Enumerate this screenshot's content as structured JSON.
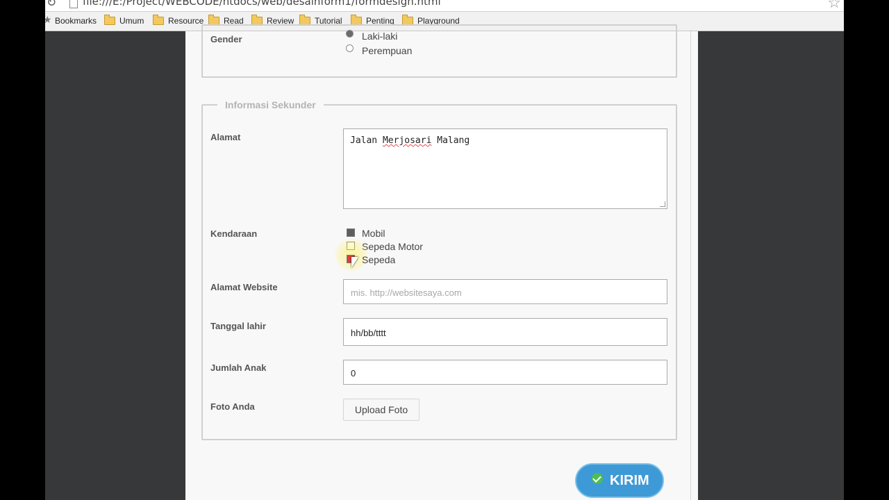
{
  "browser": {
    "url": "file:///E:/Project/WEBCODE/htdocs/web/desainform1/formdesign.html",
    "bookmarks_label": "Bookmarks",
    "folders": [
      "Umum",
      "Resource",
      "Read",
      "Review",
      "Tutorial",
      "Penting",
      "Playground"
    ]
  },
  "form": {
    "gender": {
      "label": "Gender",
      "options": [
        {
          "label": "Laki-laki",
          "checked": true
        },
        {
          "label": "Perempuan",
          "checked": false
        }
      ]
    },
    "secondary": {
      "legend": "Informasi Sekunder",
      "alamat": {
        "label": "Alamat",
        "value_start": "Jalan ",
        "value_misspelled": "Merjosari",
        "value_end": " Malang"
      },
      "kendaraan": {
        "label": "Kendaraan",
        "options": [
          {
            "label": "Mobil",
            "checked": true
          },
          {
            "label": "Sepeda Motor",
            "checked": false
          },
          {
            "label": "Sepeda",
            "checked": true
          }
        ]
      },
      "website": {
        "label": "Alamat Website",
        "placeholder": "mis. http://websitesaya.com"
      },
      "tanggal": {
        "label": "Tanggal lahir",
        "value": "hh/bb/tttt"
      },
      "anak": {
        "label": "Jumlah Anak",
        "value": "0"
      },
      "foto": {
        "label": "Foto Anda",
        "button": "Upload Foto"
      }
    },
    "submit": {
      "label": "KIRIM"
    }
  },
  "colors": {
    "accent": "#3e9ad6",
    "check_icon": "#4bbf4f",
    "page_dark": "#37383a"
  }
}
